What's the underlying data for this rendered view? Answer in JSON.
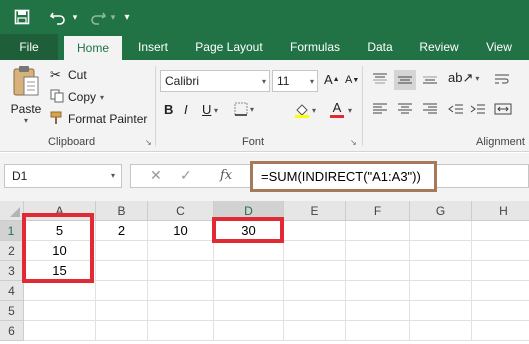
{
  "tabs": [
    "File",
    "Home",
    "Insert",
    "Page Layout",
    "Formulas",
    "Data",
    "Review",
    "View"
  ],
  "clipboard": {
    "paste": "Paste",
    "cut": "Cut",
    "copy": "Copy",
    "format_painter": "Format Painter",
    "label": "Clipboard"
  },
  "font": {
    "name": "Calibri",
    "size": "11",
    "label": "Font"
  },
  "alignment": {
    "label": "Alignment"
  },
  "formula_bar": {
    "name_box": "D1",
    "fx": "fx",
    "formula": "=SUM(INDIRECT(\"A1:A3\"))"
  },
  "grid": {
    "columns": [
      "A",
      "B",
      "C",
      "D",
      "E",
      "F",
      "G",
      "H"
    ],
    "rows": [
      "1",
      "2",
      "3",
      "4",
      "5",
      "6"
    ],
    "cells": {
      "A1": "5",
      "B1": "2",
      "C1": "10",
      "D1": "30",
      "A2": "10",
      "A3": "15"
    }
  },
  "colors": {
    "excel_green": "#217346",
    "highlight_red": "#e12a33",
    "formula_outline": "#a57a5a"
  }
}
